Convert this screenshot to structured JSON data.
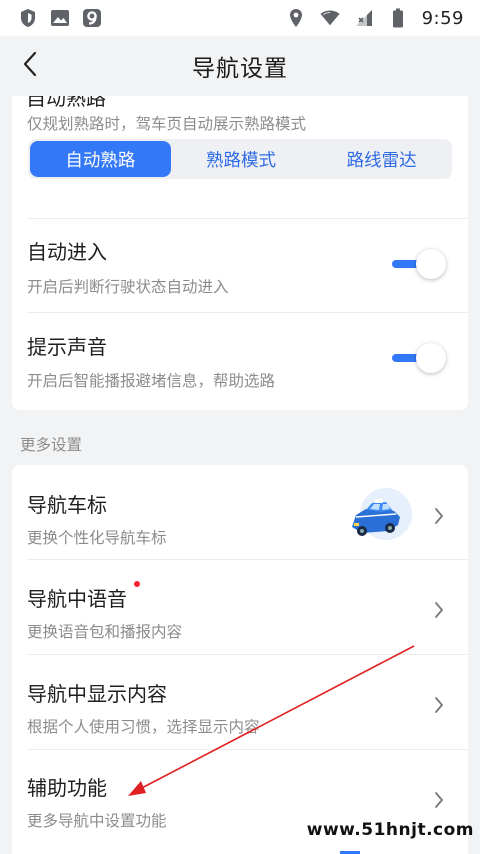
{
  "status_bar": {
    "time": "9:59",
    "left_icons": [
      "shield-icon",
      "image-icon",
      "app-9-icon"
    ],
    "right_icons": [
      "location-icon",
      "wifi-icon",
      "signal-icon",
      "battery-icon"
    ]
  },
  "header": {
    "title": "导航设置",
    "back_icon": "chevron-left-icon"
  },
  "section_top": {
    "clipped_title": "自动熟路",
    "description": "仅规划熟路时，驾车页自动展示熟路模式",
    "segments": [
      {
        "label": "自动熟路",
        "active": true
      },
      {
        "label": "熟路模式",
        "active": false
      },
      {
        "label": "路线雷达",
        "active": false
      }
    ],
    "toggles": [
      {
        "title": "自动进入",
        "description": "开启后判断行驶状态自动进入",
        "on": true
      },
      {
        "title": "提示声音",
        "description": "开启后智能播报避堵信息，帮助选路",
        "on": true
      }
    ]
  },
  "more_settings": {
    "label": "更多设置",
    "items": [
      {
        "title": "导航车标",
        "description": "更换个性化导航车标",
        "thumbnail": "car-icon",
        "badge": false
      },
      {
        "title": "导航中语音",
        "description": "更换语音包和播报内容",
        "badge": true
      },
      {
        "title": "导航中显示内容",
        "description": "根据个人使用习惯，选择显示内容",
        "badge": false
      },
      {
        "title": "辅助功能",
        "description": "更多导航中设置功能",
        "badge": false
      }
    ]
  },
  "watermark": "www.51hnjt.com",
  "colors": {
    "accent": "#3378f6",
    "background": "#f2f3f5",
    "card": "#ffffff",
    "secondary_text": "#8c8c8c",
    "badge": "#f5222d",
    "annotation_arrow": "#e02020"
  }
}
